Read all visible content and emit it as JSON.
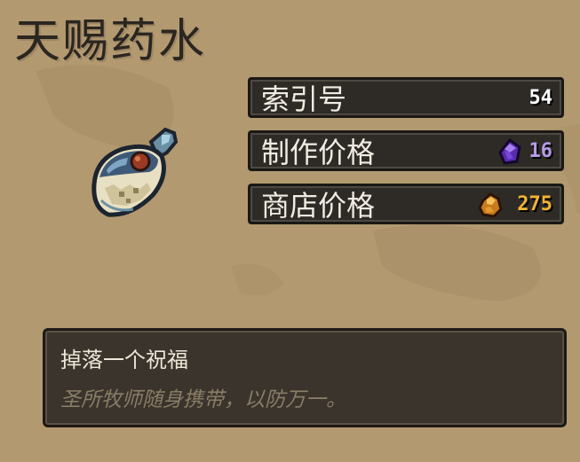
{
  "item": {
    "name": "天赐药水",
    "icon": "potion-icon"
  },
  "stats": [
    {
      "label": "索引号",
      "value": "54",
      "value_color": "#ffffff",
      "icon": null
    },
    {
      "label": "制作价格",
      "value": "16",
      "value_color": "#b79be6",
      "icon": "purple-gem-icon"
    },
    {
      "label": "商店价格",
      "value": "275",
      "value_color": "#f0b432",
      "icon": "gold-nugget-icon"
    }
  ],
  "description": {
    "effect": "掉落一个祝福",
    "flavor": "圣所牧师随身携带，以防万一。"
  },
  "colors": {
    "background": "#b49a70",
    "panel": "#2e2b27",
    "crafting_price": "#b79be6",
    "shop_price": "#f0b432"
  }
}
